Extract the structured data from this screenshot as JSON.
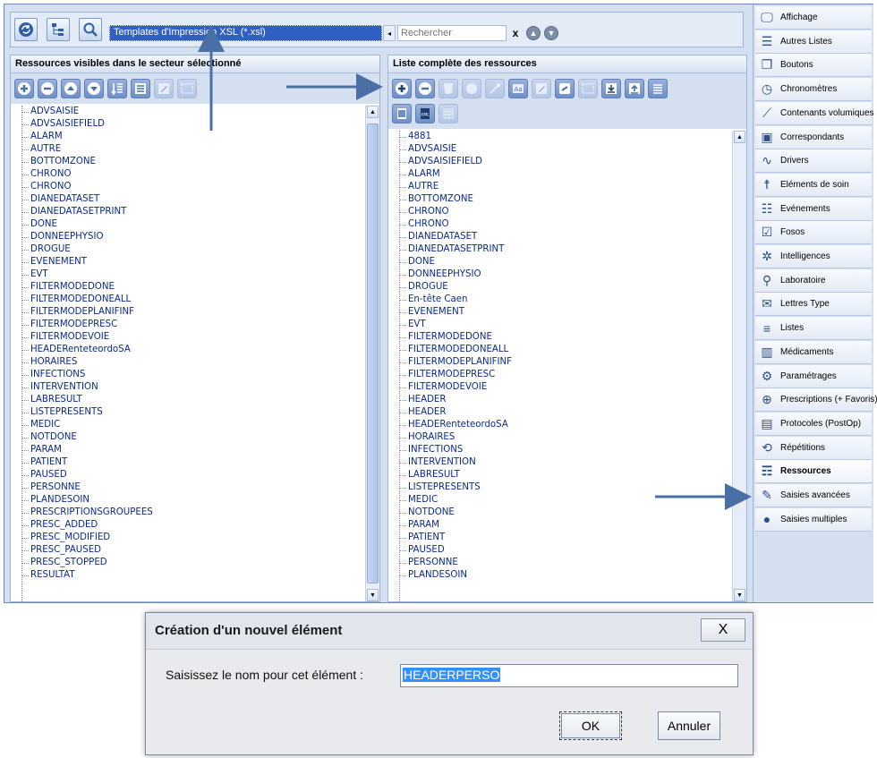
{
  "topbar": {
    "template_value": "Templates d'Impression XSL (*.xsl)",
    "search_placeholder": "Rechercher",
    "clear_label": "x"
  },
  "left_panel": {
    "title": "Ressources visibles dans le secteur sélectionné",
    "items": [
      "ADVSAISIE",
      "ADVSAISIEFIELD",
      "ALARM",
      "AUTRE",
      "BOTTOMZONE",
      "CHRONO",
      "CHRONO",
      "DIANEDATASET",
      "DIANEDATASETPRINT",
      "DONE",
      "DONNEEPHYSIO",
      "DROGUE",
      "EVENEMENT",
      "EVT",
      "FILTERMODEDONE",
      "FILTERMODEDONEALL",
      "FILTERMODEPLANIFINF",
      "FILTERMODEPRESC",
      "FILTERMODEVOIE",
      "HEADERenteteordoSA",
      "HORAIRES",
      "INFECTIONS",
      "INTERVENTION",
      "LABRESULT",
      "LISTEPRESENTS",
      "MEDIC",
      "NOTDONE",
      "PARAM",
      "PATIENT",
      "PAUSED",
      "PERSONNE",
      "PLANDESOIN",
      "PRESCRIPTIONSGROUPEES",
      "PRESC_ADDED",
      "PRESC_MODIFIED",
      "PRESC_PAUSED",
      "PRESC_STOPPED",
      "RESULTAT"
    ]
  },
  "right_panel": {
    "title": "Liste complète des ressources",
    "items": [
      "4881",
      "ADVSAISIE",
      "ADVSAISIEFIELD",
      "ALARM",
      "AUTRE",
      "BOTTOMZONE",
      "CHRONO",
      "CHRONO",
      "DIANEDATASET",
      "DIANEDATASETPRINT",
      "DONE",
      "DONNEEPHYSIO",
      "DROGUE",
      "En-tête Caen",
      "EVENEMENT",
      "EVT",
      "FILTERMODEDONE",
      "FILTERMODEDONEALL",
      "FILTERMODEPLANIFINF",
      "FILTERMODEPRESC",
      "FILTERMODEVOIE",
      "HEADER",
      "HEADER",
      "HEADERenteteordoSA",
      "HORAIRES",
      "INFECTIONS",
      "INTERVENTION",
      "LABRESULT",
      "LISTEPRESENTS",
      "MEDIC",
      "NOTDONE",
      "PARAM",
      "PATIENT",
      "PAUSED",
      "PERSONNE",
      "PLANDESOIN"
    ]
  },
  "sidebar": {
    "items": [
      {
        "label": "Affichage",
        "icon": "monitor-icon"
      },
      {
        "label": "Autres Listes",
        "icon": "numbered-list-icon"
      },
      {
        "label": "Boutons",
        "icon": "windows-icon"
      },
      {
        "label": "Chronomètres",
        "icon": "clock-icon"
      },
      {
        "label": "Contenants volumiques",
        "icon": "syringe-icon"
      },
      {
        "label": "Correspondants",
        "icon": "contact-card-icon"
      },
      {
        "label": "Drivers",
        "icon": "waveform-icon"
      },
      {
        "label": "Eléments de soin",
        "icon": "person-icon"
      },
      {
        "label": "Evénements",
        "icon": "event-list-icon"
      },
      {
        "label": "Fosos",
        "icon": "checklist-icon"
      },
      {
        "label": "Intelligences",
        "icon": "gear-star-icon"
      },
      {
        "label": "Laboratoire",
        "icon": "microscope-icon"
      },
      {
        "label": "Lettres Type",
        "icon": "letter-icon"
      },
      {
        "label": "Listes",
        "icon": "list-icon"
      },
      {
        "label": "Médicaments",
        "icon": "pills-icon"
      },
      {
        "label": "Paramétrages",
        "icon": "gears-icon"
      },
      {
        "label": "Prescriptions (+ Favoris)",
        "icon": "prescription-icon"
      },
      {
        "label": "Protocoles (PostOp)",
        "icon": "protocol-icon"
      },
      {
        "label": "Répétitions",
        "icon": "repeat-icon"
      },
      {
        "label": "Ressources",
        "icon": "resources-icon"
      },
      {
        "label": "Saisies avancées",
        "icon": "advanced-entry-icon"
      },
      {
        "label": "Saisies multiples",
        "icon": "multiple-entry-icon"
      }
    ],
    "selected": "Ressources"
  },
  "dialog": {
    "title": "Création d'un nouvel élément",
    "close_label": "X",
    "prompt": "Saisissez le nom pour cet élément :",
    "input_value": "HEADERPERSO",
    "ok_label": "OK",
    "cancel_label": "Annuler"
  },
  "colors": {
    "accent": "#3060c0",
    "tree_text": "#0a2a8a",
    "annotation_arrow": "#4a6fa5",
    "selection": "#3390ff"
  }
}
